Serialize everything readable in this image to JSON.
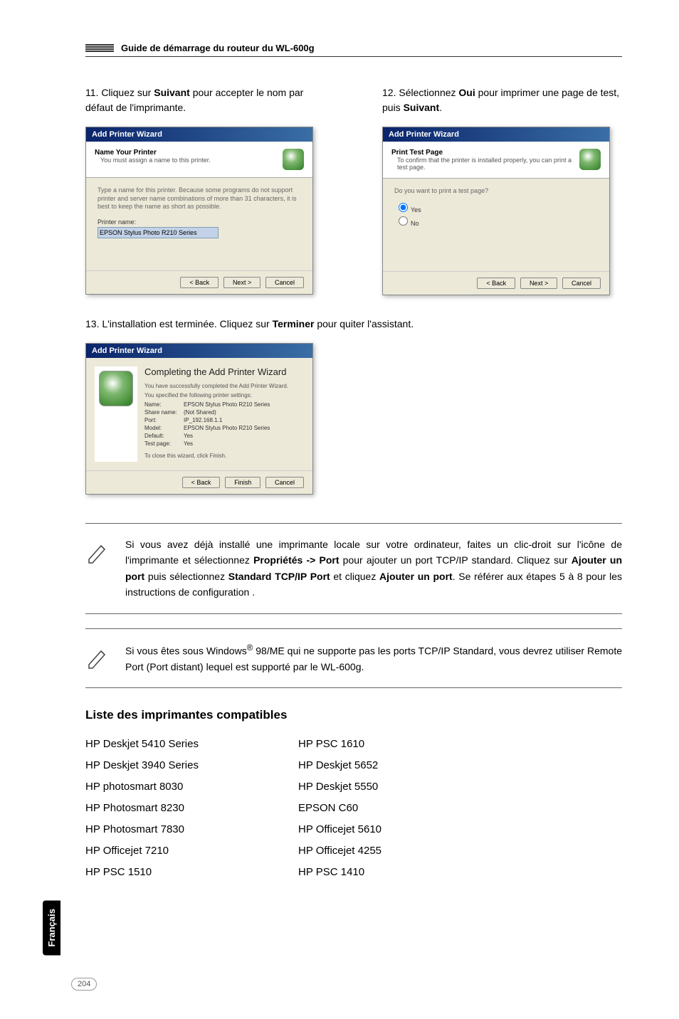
{
  "header": {
    "title": "Guide de démarrage du routeur du WL-600g"
  },
  "steps": {
    "s11": {
      "prefix": "11. Cliquez sur ",
      "bold": "Suivant",
      "suffix": " pour accepter le nom par défaut de l'imprimante."
    },
    "s12": {
      "prefix": "12. Sélectionnez ",
      "bold1": "Oui",
      "mid": " pour imprimer une page de test, puis ",
      "bold2": "Suivant",
      "suffix": "."
    },
    "s13": {
      "prefix": "13. L'installation est terminée. Cliquez sur ",
      "bold": "Terminer",
      "suffix": " pour quiter l'assistant."
    }
  },
  "wizard1": {
    "title": "Add Printer Wizard",
    "hdr": "Name Your Printer",
    "sub": "You must assign a name to this printer.",
    "desc": "Type a name for this printer. Because some programs do not support printer and server name combinations of more than 31 characters, it is best to keep the name as short as possible.",
    "label": "Printer name:",
    "value": "EPSON Stylus Photo R210 Series",
    "back": "< Back",
    "next": "Next >",
    "cancel": "Cancel"
  },
  "wizard2": {
    "title": "Add Printer Wizard",
    "hdr": "Print Test Page",
    "sub": "To confirm that the printer is installed properly, you can print a test page.",
    "q": "Do you want to print a test page?",
    "yes": "Yes",
    "no": "No",
    "back": "< Back",
    "next": "Next >",
    "cancel": "Cancel"
  },
  "wizard3": {
    "title": "Add Printer Wizard",
    "big": "Completing the Add Printer Wizard",
    "para1": "You have successfully completed the Add Printer Wizard.",
    "para2": "You specified the following printer settings:",
    "kv": {
      "name_k": "Name:",
      "name_v": "EPSON Stylus Photo R210 Series",
      "share_k": "Share name:",
      "share_v": "(Not Shared)",
      "port_k": "Port:",
      "port_v": "IP_192.168.1.1",
      "model_k": "Model:",
      "model_v": "EPSON Stylus Photo R210 Series",
      "def_k": "Default:",
      "def_v": "Yes",
      "test_k": "Test page:",
      "test_v": "Yes"
    },
    "close": "To close this wizard, click Finish.",
    "back": "< Back",
    "finish": "Finish",
    "cancel": "Cancel"
  },
  "note1": {
    "pre": "Si vous avez déjà installé une imprimante locale sur votre ordinateur, faites un clic-droit sur l'icône de l'imprimante et sélectionnez ",
    "b1": "Propriétés -> Port",
    "mid1": " pour ajouter un port TCP/IP standard. Cliquez sur ",
    "b2": "Ajouter un port",
    "mid2": " puis sélectionnez ",
    "b3": "Standard TCP/IP Port",
    "mid3": " et cliquez ",
    "b4": "Ajouter un port",
    "suf": ". Se référer aux étapes 5 à 8 pour les instructions de configuration ."
  },
  "note2": {
    "pre": "Si vous êtes sous Windows",
    "sup": "®",
    "post": " 98/ME qui ne supporte pas les ports TCP/IP Standard, vous devrez utiliser Remote Port (Port distant) lequel est supporté par le WL-600g."
  },
  "section_title": "Liste des imprimantes compatibles",
  "printers": {
    "left": [
      "HP Deskjet 5410 Series",
      "HP Deskjet 3940 Series",
      "HP photosmart 8030",
      "HP Photosmart 8230",
      "HP Photosmart 7830",
      "HP Officejet  7210",
      "HP PSC 1510"
    ],
    "right": [
      "HP PSC 1610",
      "HP Deskjet 5652",
      "HP Deskjet 5550",
      "EPSON C60",
      "HP Officejet 5610",
      "HP Officejet 4255",
      "HP  PSC 1410"
    ]
  },
  "side_tab": "Français",
  "page_number": "204"
}
